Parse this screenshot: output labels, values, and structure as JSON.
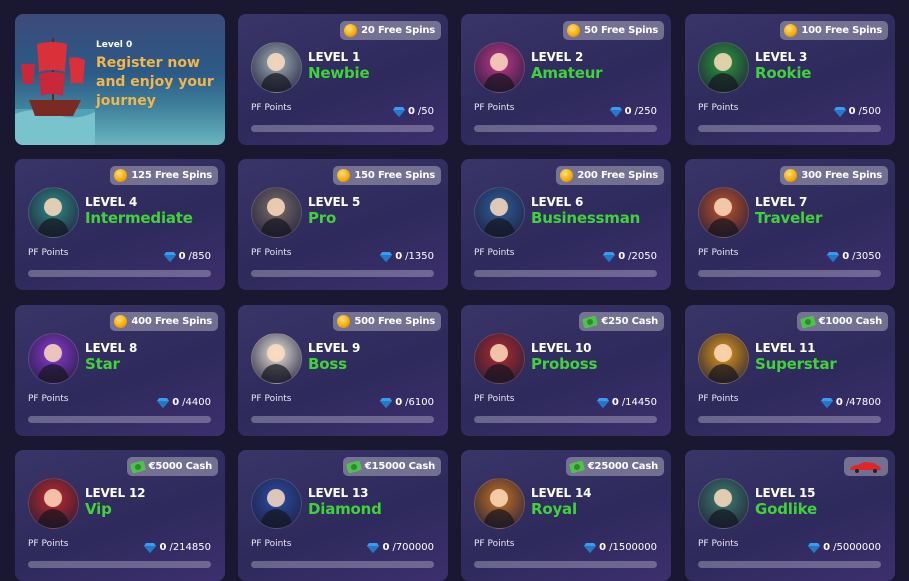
{
  "promo": {
    "level_label": "Level 0",
    "headline": "Register now and enjoy your journey"
  },
  "pf_label": "PF Points",
  "levels": [
    {
      "level": "LEVEL 1",
      "rank": "Newbie",
      "reward": "20 Free Spins",
      "reward_type": "coin",
      "points": "0",
      "max": "/50",
      "avatar_color": "#9fb3b8"
    },
    {
      "level": "LEVEL 2",
      "rank": "Amateur",
      "reward": "50 Free Spins",
      "reward_type": "coin",
      "points": "0",
      "max": "/250",
      "avatar_color": "#c2388a"
    },
    {
      "level": "LEVEL 3",
      "rank": "Rookie",
      "reward": "100 Free Spins",
      "reward_type": "coin",
      "points": "0",
      "max": "/500",
      "avatar_color": "#2c9a3c"
    },
    {
      "level": "LEVEL 4",
      "rank": "Intermediate",
      "reward": "125 Free Spins",
      "reward_type": "coin",
      "points": "0",
      "max": "/850",
      "avatar_color": "#2f8c84"
    },
    {
      "level": "LEVEL 5",
      "rank": "Pro",
      "reward": "150 Free Spins",
      "reward_type": "coin",
      "points": "0",
      "max": "/1350",
      "avatar_color": "#7a6e6a"
    },
    {
      "level": "LEVEL 6",
      "rank": "Businessman",
      "reward": "200 Free Spins",
      "reward_type": "coin",
      "points": "0",
      "max": "/2050",
      "avatar_color": "#2d5f9b"
    },
    {
      "level": "LEVEL 7",
      "rank": "Traveler",
      "reward": "300 Free Spins",
      "reward_type": "coin",
      "points": "0",
      "max": "/3050",
      "avatar_color": "#c0542a"
    },
    {
      "level": "LEVEL 8",
      "rank": "Star",
      "reward": "400 Free Spins",
      "reward_type": "coin",
      "points": "0",
      "max": "/4400",
      "avatar_color": "#8a3ad0"
    },
    {
      "level": "LEVEL 9",
      "rank": "Boss",
      "reward": "500 Free Spins",
      "reward_type": "coin",
      "points": "0",
      "max": "/6100",
      "avatar_color": "#e9e6dc"
    },
    {
      "level": "LEVEL 10",
      "rank": "Proboss",
      "reward": "€250 Cash",
      "reward_type": "cash",
      "points": "0",
      "max": "/14450",
      "avatar_color": "#b02c2c"
    },
    {
      "level": "LEVEL 11",
      "rank": "Superstar",
      "reward": "€1000 Cash",
      "reward_type": "cash",
      "points": "0",
      "max": "/47800",
      "avatar_color": "#e09a1a"
    },
    {
      "level": "LEVEL 12",
      "rank": "Vip",
      "reward": "€5000 Cash",
      "reward_type": "cash",
      "points": "0",
      "max": "/214850",
      "avatar_color": "#c22a2a"
    },
    {
      "level": "LEVEL 13",
      "rank": "Diamond",
      "reward": "€15000 Cash",
      "reward_type": "cash",
      "points": "0",
      "max": "/700000",
      "avatar_color": "#2a4ea6"
    },
    {
      "level": "LEVEL 14",
      "rank": "Royal",
      "reward": "€25000 Cash",
      "reward_type": "cash",
      "points": "0",
      "max": "/1500000",
      "avatar_color": "#c77422"
    },
    {
      "level": "LEVEL 15",
      "rank": "Godlike",
      "reward": "",
      "reward_type": "car",
      "points": "0",
      "max": "/5000000",
      "avatar_color": "#3e7f6c"
    }
  ],
  "colors": {
    "rank": "#41d23a",
    "coin": "#f5a800",
    "cash": "#4ec24a",
    "gem": "#3a9cf0"
  }
}
